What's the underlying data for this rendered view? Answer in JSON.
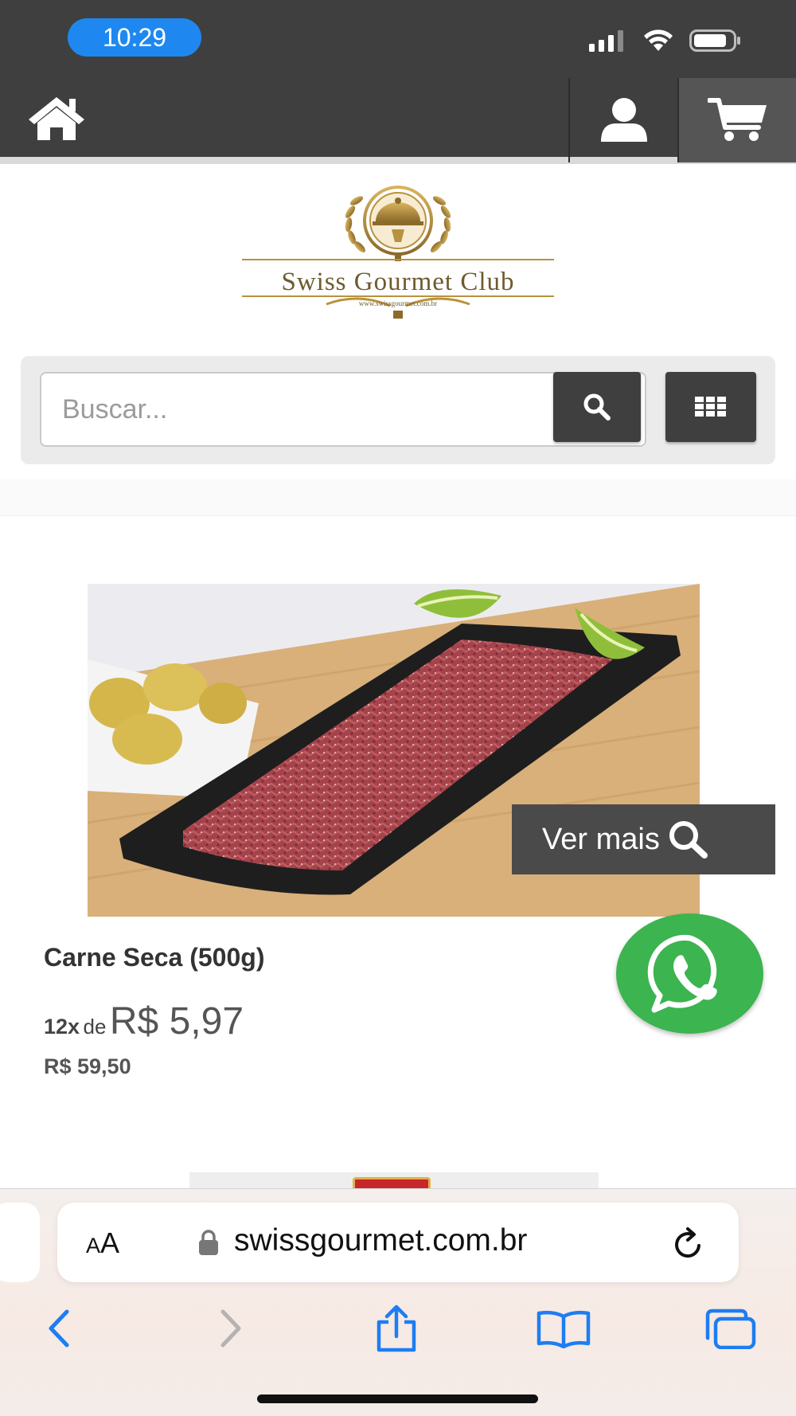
{
  "status_bar": {
    "time": "10:29"
  },
  "nav": {
    "home_icon": "home-icon",
    "user_icon": "user-icon",
    "cart_icon": "cart-icon"
  },
  "logo": {
    "name": "Swiss Gourmet Club",
    "url": "www.swissgourmet.com.br"
  },
  "search": {
    "placeholder": "Buscar...",
    "search_icon": "search-icon",
    "grid_icon": "grid-icon"
  },
  "product": {
    "ver_mais": "Ver mais",
    "title": "Carne Seca (500g)",
    "installment_count": "12x",
    "installment_de": "de",
    "installment_value": "R$ 5,97",
    "full_price": "R$ 59,50"
  },
  "browser": {
    "aa_small": "A",
    "aa_large": "A",
    "url": "swissgourmet.com.br"
  },
  "colors": {
    "header_bg": "#3f3f3f",
    "time_pill": "#1e88f0",
    "whatsapp": "#3cb44f",
    "safari_blue": "#1e7df2",
    "gold": "#b8923e"
  }
}
